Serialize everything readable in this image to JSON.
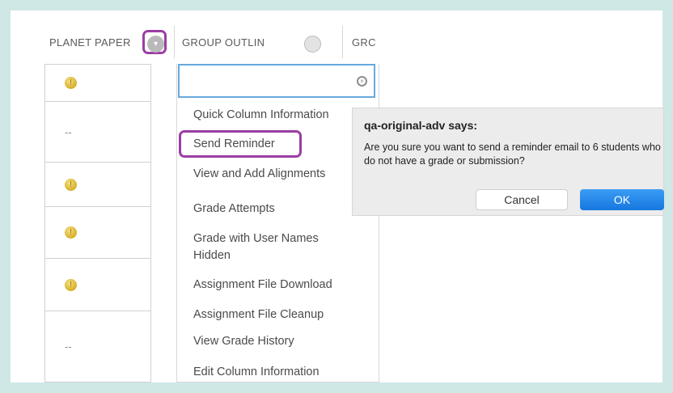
{
  "table": {
    "columns": [
      {
        "label": "PLANET PAPER"
      },
      {
        "label": "GROUP OUTLIN"
      },
      {
        "label": "GRC"
      }
    ],
    "rows": [
      {
        "status": "needs-grading"
      },
      {
        "status": "none",
        "text": "--"
      },
      {
        "status": "needs-grading"
      },
      {
        "status": "needs-grading"
      },
      {
        "status": "needs-grading"
      },
      {
        "status": "none",
        "text": "--"
      }
    ],
    "icons": {
      "column_menu": "chevron-down-icon",
      "needs_grading": "exclamation-icon",
      "search_clear": "clear-icon"
    }
  },
  "menu": {
    "search_placeholder": "",
    "items": [
      "Quick Column Information",
      "Send Reminder",
      "View and Add Alignments",
      "Grade Attempts",
      "Grade with User Names Hidden",
      "Assignment File Download",
      "Assignment File Cleanup",
      "View Grade History",
      "Edit Column Information"
    ]
  },
  "dialog": {
    "title": "qa-original-adv says:",
    "message": "Are you sure you want to send a reminder email to 6 students who do not have a grade or submission?",
    "cancel_label": "Cancel",
    "ok_label": "OK"
  },
  "colors": {
    "highlight": "#9b3ea4",
    "ok_button": "#1577e0",
    "search_border": "#67a9dd",
    "background": "#cfe8e6"
  }
}
